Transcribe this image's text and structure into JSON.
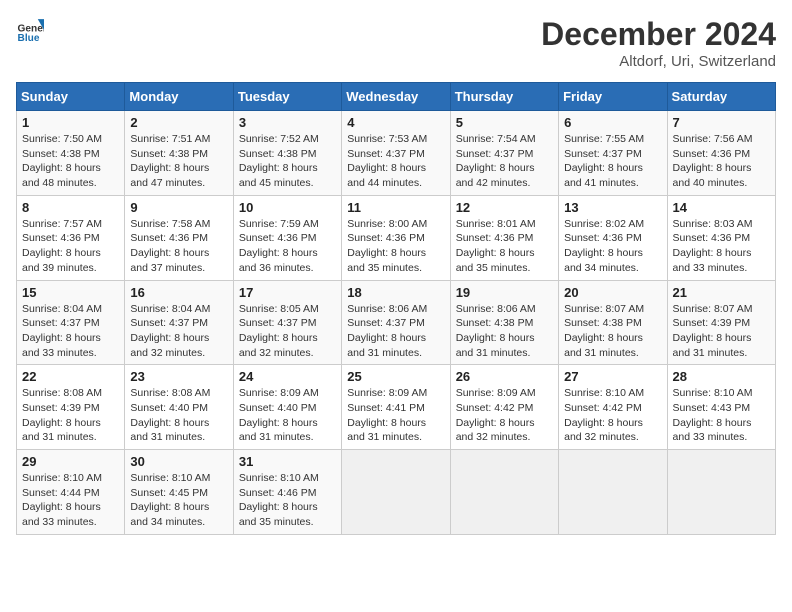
{
  "header": {
    "logo": {
      "general": "General",
      "blue": "Blue"
    },
    "title": "December 2024",
    "location": "Altdorf, Uri, Switzerland"
  },
  "calendar": {
    "weekdays": [
      "Sunday",
      "Monday",
      "Tuesday",
      "Wednesday",
      "Thursday",
      "Friday",
      "Saturday"
    ],
    "weeks": [
      [
        {
          "day": "1",
          "sunrise": "7:50 AM",
          "sunset": "4:38 PM",
          "daylight": "8 hours and 48 minutes."
        },
        {
          "day": "2",
          "sunrise": "7:51 AM",
          "sunset": "4:38 PM",
          "daylight": "8 hours and 47 minutes."
        },
        {
          "day": "3",
          "sunrise": "7:52 AM",
          "sunset": "4:38 PM",
          "daylight": "8 hours and 45 minutes."
        },
        {
          "day": "4",
          "sunrise": "7:53 AM",
          "sunset": "4:37 PM",
          "daylight": "8 hours and 44 minutes."
        },
        {
          "day": "5",
          "sunrise": "7:54 AM",
          "sunset": "4:37 PM",
          "daylight": "8 hours and 42 minutes."
        },
        {
          "day": "6",
          "sunrise": "7:55 AM",
          "sunset": "4:37 PM",
          "daylight": "8 hours and 41 minutes."
        },
        {
          "day": "7",
          "sunrise": "7:56 AM",
          "sunset": "4:36 PM",
          "daylight": "8 hours and 40 minutes."
        }
      ],
      [
        {
          "day": "8",
          "sunrise": "7:57 AM",
          "sunset": "4:36 PM",
          "daylight": "8 hours and 39 minutes."
        },
        {
          "day": "9",
          "sunrise": "7:58 AM",
          "sunset": "4:36 PM",
          "daylight": "8 hours and 37 minutes."
        },
        {
          "day": "10",
          "sunrise": "7:59 AM",
          "sunset": "4:36 PM",
          "daylight": "8 hours and 36 minutes."
        },
        {
          "day": "11",
          "sunrise": "8:00 AM",
          "sunset": "4:36 PM",
          "daylight": "8 hours and 35 minutes."
        },
        {
          "day": "12",
          "sunrise": "8:01 AM",
          "sunset": "4:36 PM",
          "daylight": "8 hours and 35 minutes."
        },
        {
          "day": "13",
          "sunrise": "8:02 AM",
          "sunset": "4:36 PM",
          "daylight": "8 hours and 34 minutes."
        },
        {
          "day": "14",
          "sunrise": "8:03 AM",
          "sunset": "4:36 PM",
          "daylight": "8 hours and 33 minutes."
        }
      ],
      [
        {
          "day": "15",
          "sunrise": "8:04 AM",
          "sunset": "4:37 PM",
          "daylight": "8 hours and 33 minutes."
        },
        {
          "day": "16",
          "sunrise": "8:04 AM",
          "sunset": "4:37 PM",
          "daylight": "8 hours and 32 minutes."
        },
        {
          "day": "17",
          "sunrise": "8:05 AM",
          "sunset": "4:37 PM",
          "daylight": "8 hours and 32 minutes."
        },
        {
          "day": "18",
          "sunrise": "8:06 AM",
          "sunset": "4:37 PM",
          "daylight": "8 hours and 31 minutes."
        },
        {
          "day": "19",
          "sunrise": "8:06 AM",
          "sunset": "4:38 PM",
          "daylight": "8 hours and 31 minutes."
        },
        {
          "day": "20",
          "sunrise": "8:07 AM",
          "sunset": "4:38 PM",
          "daylight": "8 hours and 31 minutes."
        },
        {
          "day": "21",
          "sunrise": "8:07 AM",
          "sunset": "4:39 PM",
          "daylight": "8 hours and 31 minutes."
        }
      ],
      [
        {
          "day": "22",
          "sunrise": "8:08 AM",
          "sunset": "4:39 PM",
          "daylight": "8 hours and 31 minutes."
        },
        {
          "day": "23",
          "sunrise": "8:08 AM",
          "sunset": "4:40 PM",
          "daylight": "8 hours and 31 minutes."
        },
        {
          "day": "24",
          "sunrise": "8:09 AM",
          "sunset": "4:40 PM",
          "daylight": "8 hours and 31 minutes."
        },
        {
          "day": "25",
          "sunrise": "8:09 AM",
          "sunset": "4:41 PM",
          "daylight": "8 hours and 31 minutes."
        },
        {
          "day": "26",
          "sunrise": "8:09 AM",
          "sunset": "4:42 PM",
          "daylight": "8 hours and 32 minutes."
        },
        {
          "day": "27",
          "sunrise": "8:10 AM",
          "sunset": "4:42 PM",
          "daylight": "8 hours and 32 minutes."
        },
        {
          "day": "28",
          "sunrise": "8:10 AM",
          "sunset": "4:43 PM",
          "daylight": "8 hours and 33 minutes."
        }
      ],
      [
        {
          "day": "29",
          "sunrise": "8:10 AM",
          "sunset": "4:44 PM",
          "daylight": "8 hours and 33 minutes."
        },
        {
          "day": "30",
          "sunrise": "8:10 AM",
          "sunset": "4:45 PM",
          "daylight": "8 hours and 34 minutes."
        },
        {
          "day": "31",
          "sunrise": "8:10 AM",
          "sunset": "4:46 PM",
          "daylight": "8 hours and 35 minutes."
        },
        null,
        null,
        null,
        null
      ]
    ]
  }
}
